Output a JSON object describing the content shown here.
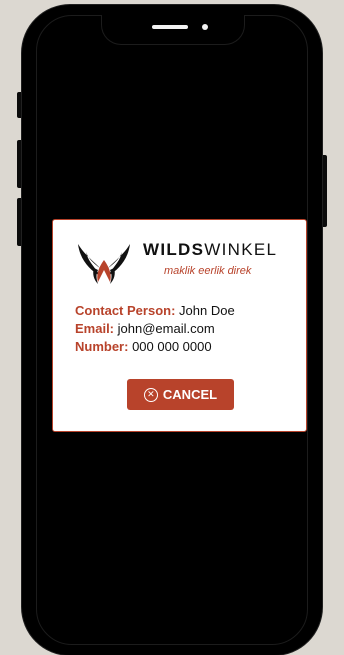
{
  "dialog": {
    "brand_bold": "WILDS",
    "brand_light": "WINKEL",
    "tagline": "maklik eerlik direk",
    "contact": {
      "person_label": "Contact Person:",
      "person_value": "John Doe",
      "email_label": "Email:",
      "email_value": "john@email.com",
      "number_label": "Number:",
      "number_value": "000 000 0000"
    },
    "cancel_label": "CANCEL",
    "cancel_icon": "⊗"
  },
  "colors": {
    "accent": "#b8432b",
    "background": "#dcd8d1",
    "device": "#000000"
  },
  "icons": {
    "logo": "antelope-horns-logo",
    "cancel": "close-circle-icon"
  }
}
